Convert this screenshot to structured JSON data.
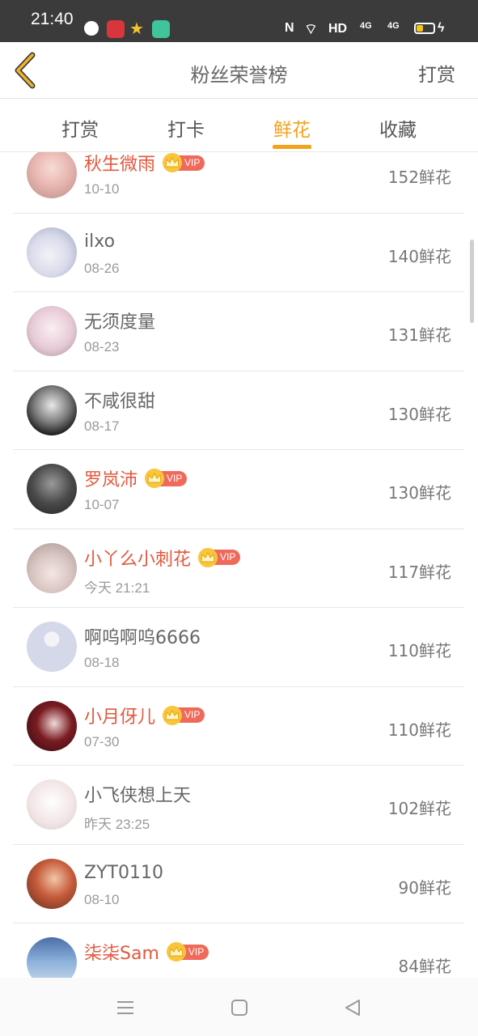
{
  "status_bar": {
    "time": "21:40",
    "network": "HD",
    "signal1": "4G",
    "signal2": "4G"
  },
  "header": {
    "title": "粉丝荣誉榜",
    "action_label": "打赏"
  },
  "tabs": [
    {
      "label": "打赏",
      "active": false
    },
    {
      "label": "打卡",
      "active": false
    },
    {
      "label": "鲜花",
      "active": true
    },
    {
      "label": "收藏",
      "active": false
    }
  ],
  "vip_label": "VIP",
  "accent_color": "#f5a21b",
  "vip_name_color": "#e2583e",
  "fans": [
    {
      "name": "秋生微雨",
      "date": "10-10",
      "count": "152鲜花",
      "vip": true
    },
    {
      "name": "ilxo",
      "date": "08-26",
      "count": "140鲜花",
      "vip": false
    },
    {
      "name": "无须度量",
      "date": "08-23",
      "count": "131鲜花",
      "vip": false
    },
    {
      "name": "不咸很甜",
      "date": "08-17",
      "count": "130鲜花",
      "vip": false
    },
    {
      "name": "罗岚沛",
      "date": "10-07",
      "count": "130鲜花",
      "vip": true
    },
    {
      "name": "小丫么小刺花",
      "date": "今天 21:21",
      "count": "117鲜花",
      "vip": true
    },
    {
      "name": "啊呜啊呜6666",
      "date": "08-18",
      "count": "110鲜花",
      "vip": false
    },
    {
      "name": "小月伢儿",
      "date": "07-30",
      "count": "110鲜花",
      "vip": true
    },
    {
      "name": "小飞侠想上天",
      "date": "昨天 23:25",
      "count": "102鲜花",
      "vip": false
    },
    {
      "name": "ZYT0110",
      "date": "08-10",
      "count": "90鲜花",
      "vip": false
    },
    {
      "name": "柒柒Sam",
      "date": "",
      "count": "84鲜花",
      "vip": true
    }
  ]
}
